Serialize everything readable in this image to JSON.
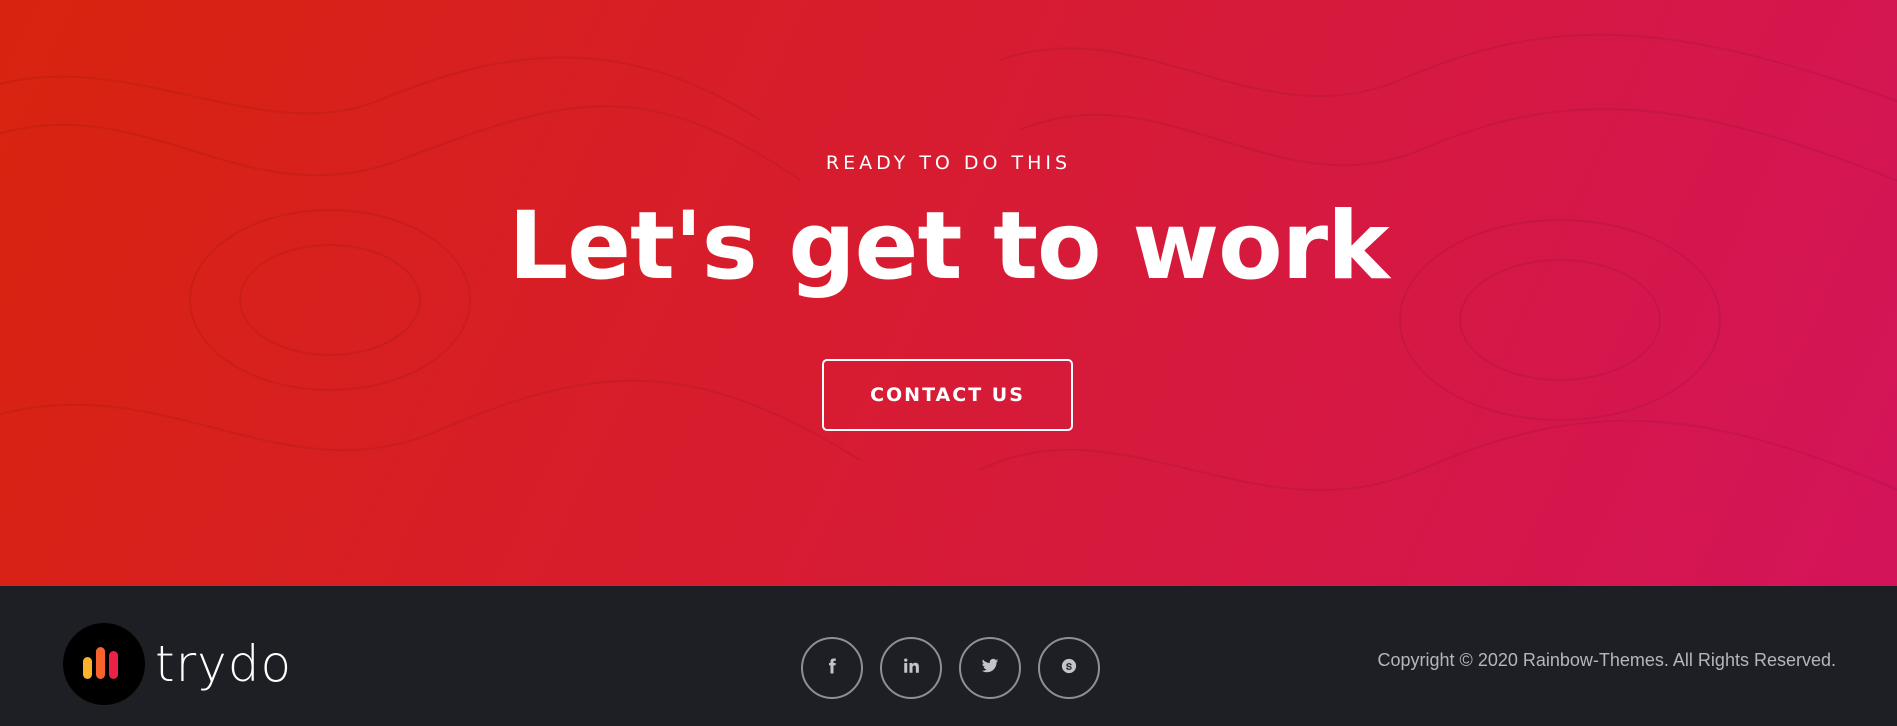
{
  "cta": {
    "subtitle": "READY TO DO THIS",
    "headline": "Let's get to work",
    "button_label": "CONTACT US"
  },
  "footer": {
    "logo_text": "trydo",
    "social_links": [
      {
        "name": "facebook",
        "icon": "facebook-icon"
      },
      {
        "name": "linkedin",
        "icon": "linkedin-icon"
      },
      {
        "name": "twitter",
        "icon": "twitter-icon"
      },
      {
        "name": "skype",
        "icon": "skype-icon"
      }
    ],
    "copyright": "Copyright © 2020 Rainbow-Themes. All Rights Reserved."
  },
  "colors": {
    "gradient_start": "#d8240e",
    "gradient_end": "#d4145a",
    "footer_bg": "#1d1f24",
    "icon_ring": "#8f9097"
  }
}
